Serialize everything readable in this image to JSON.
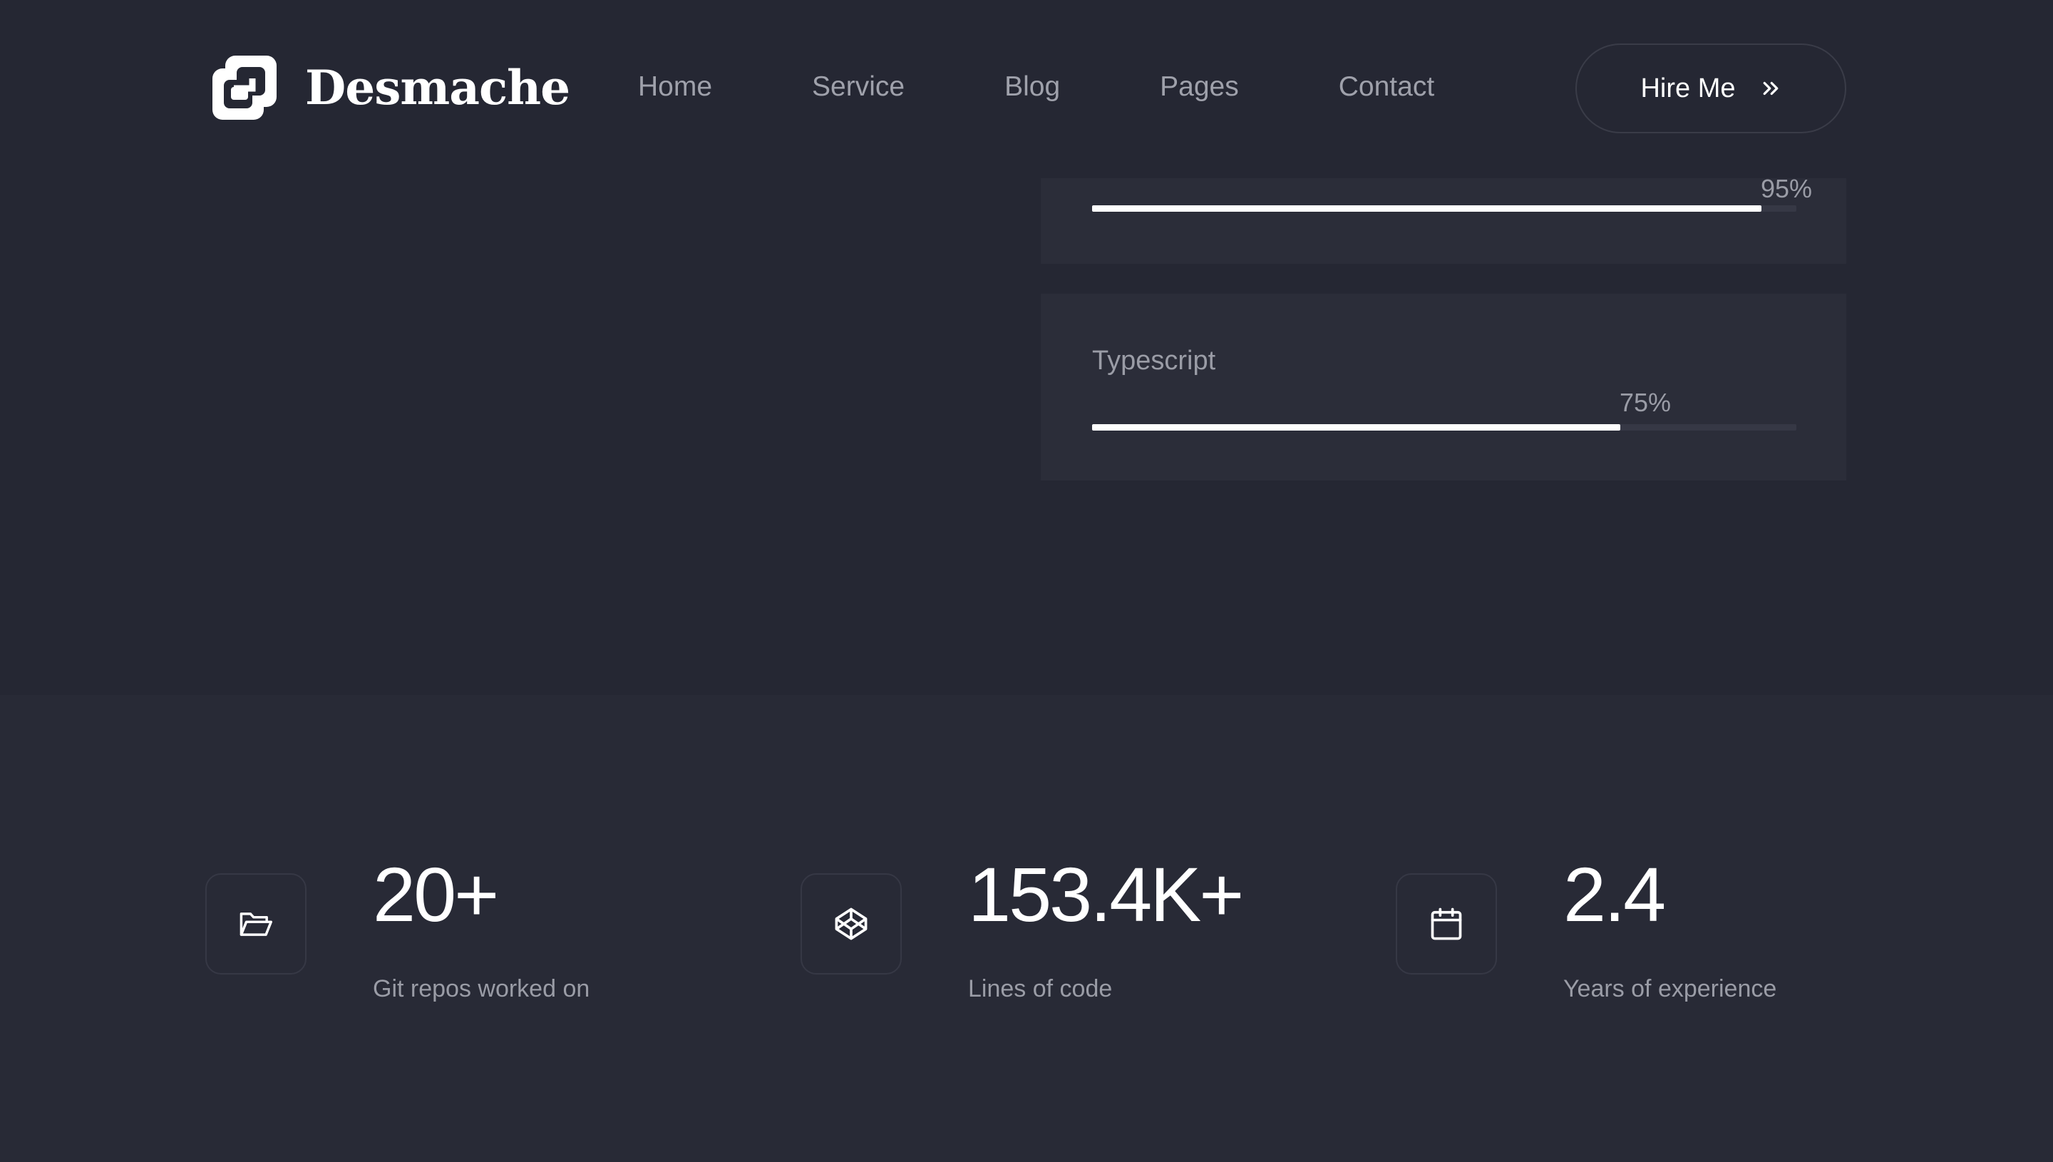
{
  "header": {
    "brand": "Desmache",
    "brand_icon": "logo-mark-icon",
    "nav": [
      "Home",
      "Service",
      "Blog",
      "Pages",
      "Contact"
    ],
    "cta_label": "Hire Me",
    "cta_icon": "double-chevron-right-icon"
  },
  "skills": [
    {
      "name": "",
      "percent_label": "95%",
      "level": 0.95
    },
    {
      "name": "Typescript",
      "percent_label": "75%",
      "level": 0.75
    }
  ],
  "stats": [
    {
      "value": "20+",
      "label": "Git repos worked on",
      "icon": "folder-open-icon"
    },
    {
      "value": "153.4K+",
      "label": "Lines of code",
      "icon": "codepen-icon"
    },
    {
      "value": "2.4",
      "label": "Years of experience",
      "icon": "calendar-icon"
    }
  ],
  "colors": {
    "background": "#252733",
    "card": "#2b2d39",
    "muted_text": "#9a9ca6",
    "accent": "#ffffff"
  }
}
